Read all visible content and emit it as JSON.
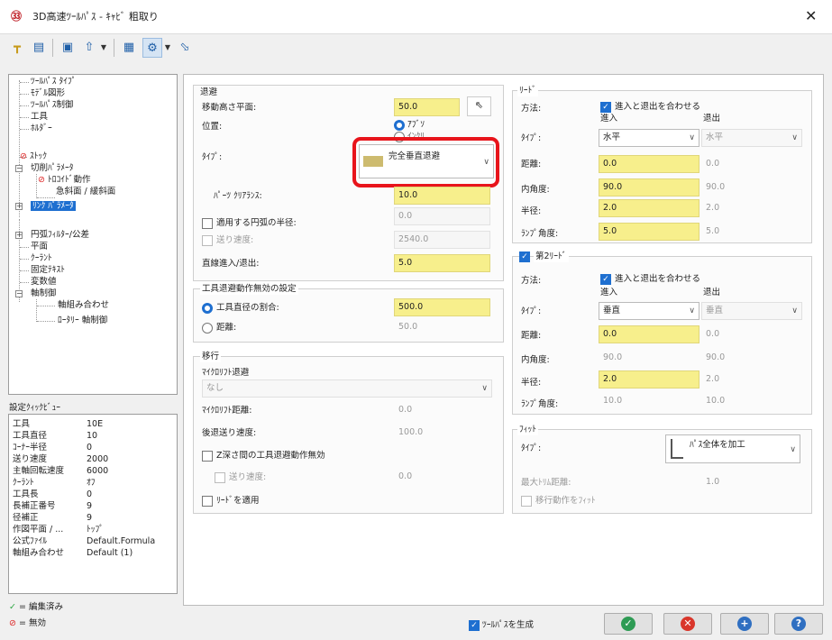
{
  "window": {
    "icon_text": "㉝",
    "title": "3D高速ﾂｰﾙﾊﾟｽ - ｷｬﾋﾞ 粗取り",
    "close": "✕"
  },
  "tree": {
    "items": [
      "ﾂｰﾙﾊﾟｽ ﾀｲﾌﾟ",
      "ﾓﾃﾞﾙ図形",
      "ﾂｰﾙﾊﾟｽ制御",
      "工具",
      "ﾎﾙﾀﾞｰ",
      "ｽﾄｯｸ",
      "切削ﾊﾟﾗﾒｰﾀ",
      "ﾄﾛｺｲﾄﾞ動作",
      "急斜面 / 緩斜面",
      "ﾘﾝｸ ﾊﾟﾗﾒｰﾀ",
      "円弧ﾌｨﾙﾀｰ/公差",
      "平面",
      "ｸｰﾗﾝﾄ",
      "固定ﾃｷｽﾄ",
      "変数値",
      "軸制御",
      "軸組み合わせ",
      "ﾛｰﾀﾘｰ 軸制御"
    ]
  },
  "quickview": {
    "label": "設定ｸｨｯｸﾋﾞｭｰ",
    "rows": [
      [
        "工具",
        "10E"
      ],
      [
        "工具直径",
        "10"
      ],
      [
        "ｺｰﾅｰ半径",
        "0"
      ],
      [
        "送り速度",
        "2000"
      ],
      [
        "主軸回転速度",
        "6000"
      ],
      [
        "ｸｰﾗﾝﾄ",
        "ｵﾌ"
      ],
      [
        "工具長",
        "0"
      ],
      [
        "長補正番号",
        "9"
      ],
      [
        "径補正",
        "9"
      ],
      [
        "作図平面 / ...",
        "ﾄｯﾌﾟ"
      ],
      [
        "公式ﾌｧｲﾙ",
        "Default.Formula"
      ],
      [
        "軸組み合わせ",
        "Default (1)"
      ]
    ]
  },
  "legend": {
    "edited": "= 編集済み",
    "disabled": "= 無効"
  },
  "retract": {
    "title": "退避",
    "height_label": "移動高さ平面:",
    "height": "50.0",
    "position_label": "位置:",
    "pos_abs": "ｱﾌﾞｿ",
    "pos_inc": "ｲﾝｸﾘ",
    "type_label": "ﾀｲﾌﾟ:",
    "type_value": "完全垂直退避",
    "clearance_label": "ﾊﾟｰﾂ ｸﾘｱﾗﾝｽ:",
    "clearance": "10.0",
    "arc_label": "適用する円弧の半径:",
    "arc": "0.0",
    "feed_label": "送り速度:",
    "feed": "2540.0",
    "linear_label": "直線進入/退出:",
    "linear": "5.0"
  },
  "disable": {
    "title": "工具退避動作無効の設定",
    "pct_label": "工具直径の割合:",
    "pct": "500.0",
    "dist_label": "距離:",
    "dist": "50.0"
  },
  "transition": {
    "title": "移行",
    "microlift_label": "ﾏｲｸﾛﾘﾌﾄ退避",
    "microlift_value": "なし",
    "mdist_label": "ﾏｲｸﾛﾘﾌﾄ距離:",
    "mdist": "0.0",
    "backfeed_label": "後退送り速度:",
    "backfeed": "100.0",
    "zdepth_label": "Z深さ間の工具退避動作無効",
    "zfeed_label": "送り速度:",
    "zfeed": "0.0",
    "applylead_label": "ﾘｰﾄﾞを適用"
  },
  "lead": {
    "title": "ﾘｰﾄﾞ",
    "method_label": "方法:",
    "match_label": "進入と退出を合わせる",
    "in": "進入",
    "out": "退出",
    "type_label": "ﾀｲﾌﾟ:",
    "type_in": "水平",
    "type_out": "水平",
    "dist_label": "距離:",
    "dist_in": "0.0",
    "dist_out": "0.0",
    "angle_label": "内角度:",
    "angle_in": "90.0",
    "angle_out": "90.0",
    "radius_label": "半径:",
    "radius_in": "2.0",
    "radius_out": "2.0",
    "ramp_label": "ﾗﾝﾌﾟ角度:",
    "ramp_in": "5.0",
    "ramp_out": "5.0"
  },
  "lead2": {
    "title": "第2ﾘｰﾄﾞ",
    "method_label": "方法:",
    "match_label": "進入と退出を合わせる",
    "in": "進入",
    "out": "退出",
    "type_label": "ﾀｲﾌﾟ:",
    "type_in": "垂直",
    "type_out": "垂直",
    "dist_label": "距離:",
    "dist_in": "0.0",
    "dist_out": "0.0",
    "angle_label": "内角度:",
    "angle_in": "90.0",
    "angle_out": "90.0",
    "radius_label": "半径:",
    "radius_in": "2.0",
    "radius_out": "2.0",
    "ramp_label": "ﾗﾝﾌﾟ角度:",
    "ramp_in": "10.0",
    "ramp_out": "10.0"
  },
  "fit": {
    "title": "ﾌｨｯﾄ",
    "type_label": "ﾀｲﾌﾟ:",
    "type_value": "ﾊﾟｽ全体を加工",
    "trim_label": "最大ﾄﾘﾑ距離:",
    "trim": "1.0",
    "fitmove_label": "移行動作をﾌｨｯﾄ"
  },
  "footer": {
    "generate": "ﾂｰﾙﾊﾟｽを生成"
  }
}
